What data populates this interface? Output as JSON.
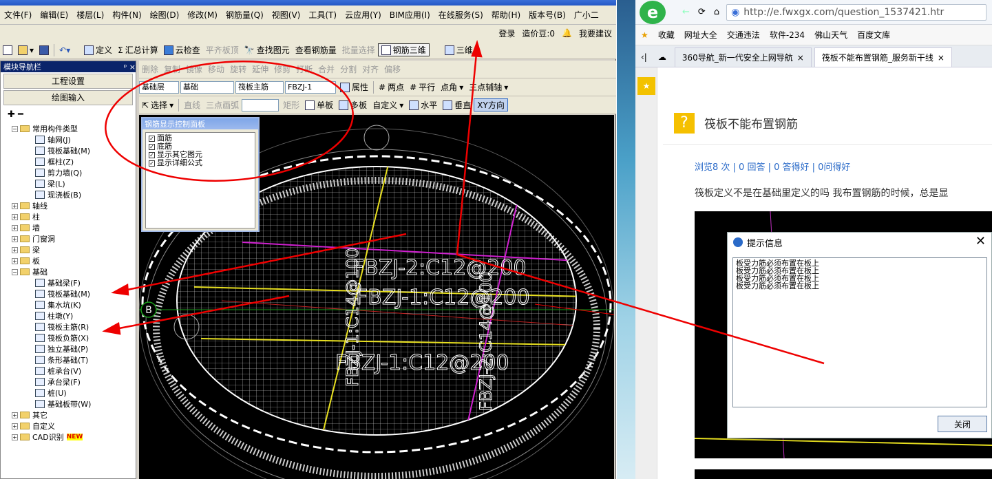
{
  "menu": [
    "文件(F)",
    "编辑(E)",
    "楼层(L)",
    "构件(N)",
    "绘图(D)",
    "修改(M)",
    "钢筋量(Q)",
    "视图(V)",
    "工具(T)",
    "云应用(Y)",
    "BIM应用(I)",
    "在线服务(S)",
    "帮助(H)",
    "版本号(B)",
    "广小二"
  ],
  "account": {
    "login": "登录",
    "coins": "造价豆:0",
    "suggest": "我要建议"
  },
  "toolbar1": {
    "define": "定义",
    "sum": "汇总计算",
    "cloud_check": "云检查",
    "flat_top": "平齐板顶",
    "find": "查找图元",
    "view_rebar": "查看钢筋量",
    "batch_select": "批量选择",
    "rebar_3d": "钢筋三维",
    "three_d": "三维"
  },
  "toolbar2": [
    "删除",
    "复制",
    "镜像",
    "移动",
    "旋转",
    "延伸",
    "修剪",
    "打断",
    "合并",
    "分割",
    "对齐",
    "偏移"
  ],
  "toolbar3": {
    "layer": "基础层",
    "category": "基础",
    "type": "筏板主筋",
    "name": "FBZJ-1",
    "props": "属性",
    "two_point": "两点",
    "parallel": "平行",
    "point_angle": "点角",
    "three_point": "三点辅轴"
  },
  "toolbar4": {
    "select": "选择",
    "line": "直线",
    "arc": "三点画弧",
    "rect": "矩形",
    "single": "单板",
    "multi": "多板",
    "custom": "自定义",
    "horizontal": "水平",
    "vertical": "垂直",
    "xy": "XY方向"
  },
  "nav": {
    "title": "模块导航栏",
    "tab1": "工程设置",
    "tab2": "绘图输入"
  },
  "tree": {
    "common": "常用构件类型",
    "common_items": [
      "轴网(J)",
      "筏板基础(M)",
      "框柱(Z)",
      "剪力墙(Q)",
      "梁(L)",
      "现浇板(B)"
    ],
    "groups": [
      "轴线",
      "柱",
      "墙",
      "门窗洞",
      "梁",
      "板"
    ],
    "foundation": "基础",
    "foundation_items": [
      "基础梁(F)",
      "筏板基础(M)",
      "集水坑(K)",
      "柱墩(Y)",
      "筏板主筋(R)",
      "筏板负筋(X)",
      "独立基础(P)",
      "条形基础(T)",
      "桩承台(V)",
      "承台梁(F)",
      "桩(U)",
      "基础板带(W)"
    ],
    "tail": [
      "其它",
      "自定义",
      "CAD识别"
    ],
    "new_badge": "NEW"
  },
  "control_panel": {
    "title": "钢筋显示控制面板",
    "options": [
      "面筋",
      "底筋",
      "显示其它图元",
      "显示详细公式"
    ]
  },
  "canvas_labels": {
    "label1": "FBZJ-2:C12@200",
    "label2": "FBZJ-1:C12@200",
    "label3": "FBZJ-1:C12@200",
    "vert1": "FBZJ-1:C14@100",
    "vert2": "FBZJ-2:C14@100",
    "axis": "B"
  },
  "browser": {
    "url": "http://e.fwxgx.com/question_1537421.htr",
    "bookmarks": [
      "收藏",
      "网址大全",
      "交通违法",
      "软件-234",
      "佛山天气",
      "百度文库"
    ],
    "tabs": [
      "360导航_新一代安全上网导航",
      "筏板不能布置钢筋_服务新干线"
    ],
    "question_title": "筏板不能布置钢筋",
    "stats": "浏览8 次 | 0 回答 | 0 答得好 | 0问得好",
    "body": "筏板定义不是在基础里定义的吗   我布置钢筋的时候，总是显"
  },
  "dialog": {
    "title": "提示信息",
    "message": "板受力筋必须布置在板上\n板受力筋必须布置在板上\n板受力筋必须布置在板上\n板受力筋必须布置在板上",
    "close": "关闭"
  }
}
